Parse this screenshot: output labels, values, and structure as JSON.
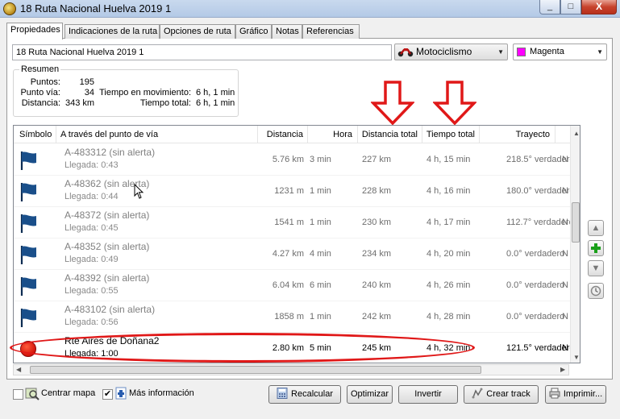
{
  "window": {
    "title": "18 Ruta Nacional Huelva 2019 1",
    "minimize": "_",
    "maximize": "□",
    "close": "X"
  },
  "tabs": [
    "Propiedades",
    "Indicaciones de la ruta",
    "Opciones de ruta",
    "Gráfico",
    "Notas",
    "Referencias"
  ],
  "route_name": "18 Ruta Nacional Huelva 2019 1",
  "activity": {
    "value": "Motociclismo",
    "icon": "motorcycle-icon"
  },
  "color": {
    "value": "Magenta",
    "swatch": "#ff00ff"
  },
  "summary": {
    "legend": "Resumen",
    "points_label": "Puntos:",
    "points_value": "195",
    "via_label": "Punto vía:",
    "via_value": "34",
    "distance_label": "Distancia:",
    "distance_value": "343 km",
    "moving_label": "Tiempo en movimiento:",
    "moving_value": "6 h, 1 min",
    "total_label": "Tiempo total:",
    "total_value": "6 h, 1 min"
  },
  "columns": [
    "Símbolo",
    "A través del punto de vía",
    "Distancia",
    "Hora",
    "Distancia total",
    "Tiempo total",
    "Trayecto"
  ],
  "rows": [
    {
      "name": "A-483312 (sin alerta)",
      "arrival": "Llegada: 0:43",
      "distance": "5.76 km",
      "time": "3 min",
      "total_distance": "227 km",
      "total_time": "4 h, 15 min",
      "heading": "218.5° verdadero",
      "extra": "N",
      "symbol": "flag-icon"
    },
    {
      "name": "A-48362 (sin alerta)",
      "arrival": "Llegada: 0:44",
      "distance": "1231 m",
      "time": "1 min",
      "total_distance": "228 km",
      "total_time": "4 h, 16 min",
      "heading": "180.0° verdadero",
      "extra": "N",
      "symbol": "flag-icon"
    },
    {
      "name": "A-48372 (sin alerta)",
      "arrival": "Llegada: 0:45",
      "distance": "1541 m",
      "time": "1 min",
      "total_distance": "230 km",
      "total_time": "4 h, 17 min",
      "heading": "112.7° verdadero",
      "extra": "N",
      "symbol": "flag-icon"
    },
    {
      "name": "A-48352 (sin alerta)",
      "arrival": "Llegada: 0:49",
      "distance": "4.27 km",
      "time": "4 min",
      "total_distance": "234 km",
      "total_time": "4 h, 20 min",
      "heading": "0.0° verdadero",
      "extra": "N",
      "symbol": "flag-icon"
    },
    {
      "name": "A-48392 (sin alerta)",
      "arrival": "Llegada: 0:55",
      "distance": "6.04 km",
      "time": "6 min",
      "total_distance": "240 km",
      "total_time": "4 h, 26 min",
      "heading": "0.0° verdadero",
      "extra": "N",
      "symbol": "flag-icon"
    },
    {
      "name": "A-483102 (sin alerta)",
      "arrival": "Llegada: 0:56",
      "distance": "1858 m",
      "time": "1 min",
      "total_distance": "242 km",
      "total_time": "4 h, 28 min",
      "heading": "0.0° verdadero",
      "extra": "N",
      "symbol": "flag-icon"
    },
    {
      "name": "Rte Aires de Doñana2",
      "arrival": "Llegada: 1:00",
      "distance": "2.80 km",
      "time": "5 min",
      "total_distance": "245 km",
      "total_time": "4 h, 32 min",
      "heading": "121.5° verdadero",
      "extra": "N",
      "symbol": "red-circle-icon"
    }
  ],
  "side_buttons": [
    "move-up-icon",
    "add-icon",
    "move-down-icon",
    "clock-icon"
  ],
  "bottom": {
    "center_map_label": "Centrar mapa",
    "center_map_checked": false,
    "more_info_label": "Más información",
    "more_info_checked": true,
    "recalc": "Recalcular",
    "optimize": "Optimizar",
    "invert": "Invertir",
    "create_track": "Crear track",
    "print": "Imprimir..."
  },
  "colors": {
    "highlight": "#e01818",
    "flag": "#1a4f8a"
  }
}
